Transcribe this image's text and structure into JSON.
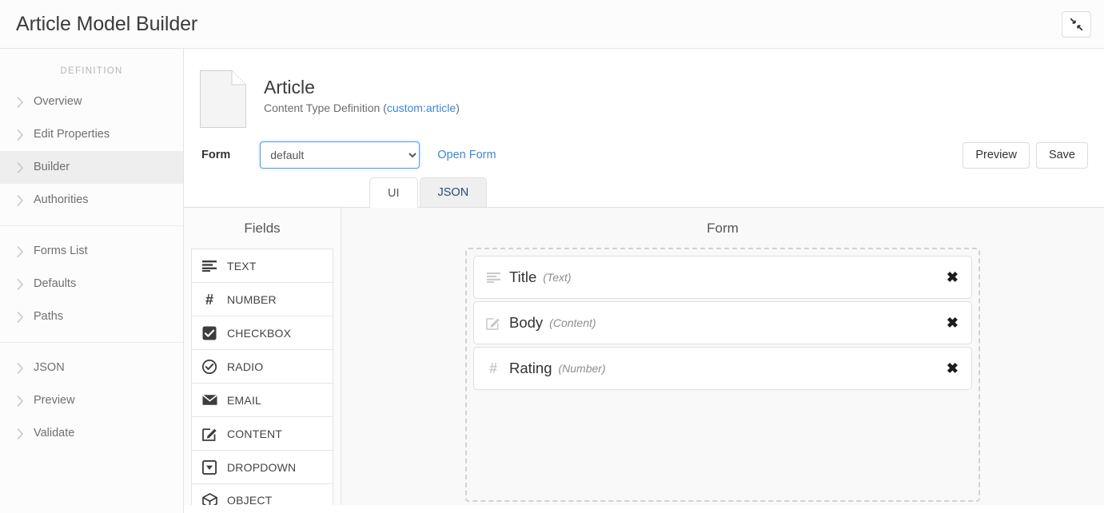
{
  "header": {
    "title": "Article Model Builder",
    "collapse_icon": "collapse-diagonal-icon"
  },
  "sidebar": {
    "section_title": "DEFINITION",
    "groups": [
      {
        "items": [
          {
            "label": "Overview",
            "active": false
          },
          {
            "label": "Edit Properties",
            "active": false
          },
          {
            "label": "Builder",
            "active": true
          },
          {
            "label": "Authorities",
            "active": false
          }
        ]
      },
      {
        "items": [
          {
            "label": "Forms List",
            "active": false
          },
          {
            "label": "Defaults",
            "active": false
          },
          {
            "label": "Paths",
            "active": false
          }
        ]
      },
      {
        "items": [
          {
            "label": "JSON",
            "active": false
          },
          {
            "label": "Preview",
            "active": false
          },
          {
            "label": "Validate",
            "active": false
          }
        ]
      }
    ]
  },
  "definition": {
    "icon": "document-icon",
    "title": "Article",
    "subtitle_prefix": "Content Type Definition (",
    "subtitle_link": "custom:article",
    "subtitle_suffix": ")"
  },
  "form_bar": {
    "label": "Form",
    "select_value": "default",
    "select_options": [
      "default"
    ],
    "open_form_label": "Open Form",
    "preview_label": "Preview",
    "save_label": "Save"
  },
  "tabs": [
    {
      "label": "UI",
      "active": true
    },
    {
      "label": "JSON",
      "active": false
    }
  ],
  "fields_panel": {
    "title": "Fields",
    "items": [
      {
        "label": "TEXT",
        "icon": "text-lines-icon"
      },
      {
        "label": "NUMBER",
        "icon": "hash-icon"
      },
      {
        "label": "CHECKBOX",
        "icon": "checkbox-icon"
      },
      {
        "label": "RADIO",
        "icon": "radio-check-circle-icon"
      },
      {
        "label": "EMAIL",
        "icon": "envelope-icon"
      },
      {
        "label": "CONTENT",
        "icon": "pencil-square-icon"
      },
      {
        "label": "DROPDOWN",
        "icon": "dropdown-caret-square-icon"
      },
      {
        "label": "OBJECT",
        "icon": "cube-icon"
      }
    ]
  },
  "form_canvas": {
    "title": "Form",
    "fields": [
      {
        "label": "Title",
        "type": "(Text)",
        "icon": "text-lines-icon",
        "remove": "✖"
      },
      {
        "label": "Body",
        "type": "(Content)",
        "icon": "pencil-square-icon",
        "remove": "✖"
      },
      {
        "label": "Rating",
        "type": "(Number)",
        "icon": "hash-icon",
        "remove": "✖"
      }
    ]
  },
  "colors": {
    "link": "#3f86d6",
    "focus_border": "#56a0e8",
    "active_nav_bg": "#eeeeee",
    "tab_inactive_text": "#2c4a70"
  }
}
